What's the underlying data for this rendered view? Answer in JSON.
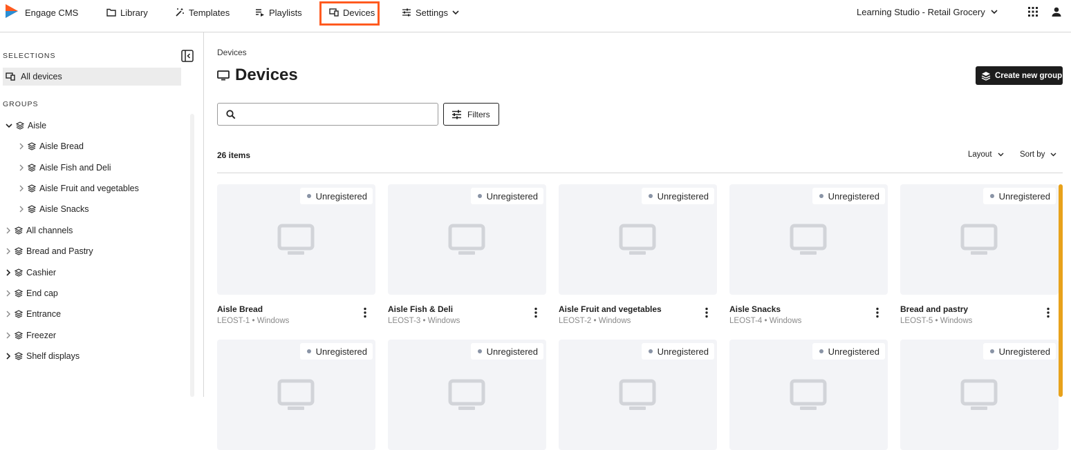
{
  "app": {
    "name": "Engage CMS",
    "logo_colors": [
      "#ff5a1f",
      "#2a8fd6"
    ]
  },
  "nav": {
    "library": "Library",
    "templates": "Templates",
    "playlists": "Playlists",
    "devices": "Devices",
    "settings": "Settings",
    "org": "Learning Studio - Retail Grocery"
  },
  "sidebar": {
    "selections_heading": "SELECTIONS",
    "all_devices": "All devices",
    "groups_heading": "GROUPS",
    "tree": [
      {
        "label": "Aisle",
        "expanded": true
      },
      {
        "label": "Aisle Bread"
      },
      {
        "label": "Aisle Fish and Deli"
      },
      {
        "label": "Aisle Fruit and vegetables"
      },
      {
        "label": "Aisle Snacks"
      },
      {
        "label": "All channels"
      },
      {
        "label": "Bread and Pastry"
      },
      {
        "label": "Cashier"
      },
      {
        "label": "End cap"
      },
      {
        "label": "Entrance"
      },
      {
        "label": "Freezer"
      },
      {
        "label": "Shelf displays"
      }
    ]
  },
  "main": {
    "breadcrumb": "Devices",
    "title": "Devices",
    "create_group": "Create new group",
    "search_value": "",
    "filters": "Filters",
    "items_count": "26 items",
    "layout": "Layout",
    "sort_by": "Sort by",
    "cards": [
      {
        "status": "Unregistered",
        "title": "Aisle Bread",
        "id": "LEOST-1",
        "os": "Windows"
      },
      {
        "status": "Unregistered",
        "title": "Aisle Fish & Deli",
        "id": "LEOST-3",
        "os": "Windows"
      },
      {
        "status": "Unregistered",
        "title": "Aisle Fruit and vegetables",
        "id": "LEOST-2",
        "os": "Windows"
      },
      {
        "status": "Unregistered",
        "title": "Aisle Snacks",
        "id": "LEOST-4",
        "os": "Windows"
      },
      {
        "status": "Unregistered",
        "title": "Bread and pastry",
        "id": "LEOST-5",
        "os": "Windows"
      },
      {
        "status": "Unregistered"
      },
      {
        "status": "Unregistered"
      },
      {
        "status": "Unregistered"
      },
      {
        "status": "Unregistered"
      },
      {
        "status": "Unregistered"
      }
    ],
    "accent_scroll_color": "#e8a21b"
  }
}
